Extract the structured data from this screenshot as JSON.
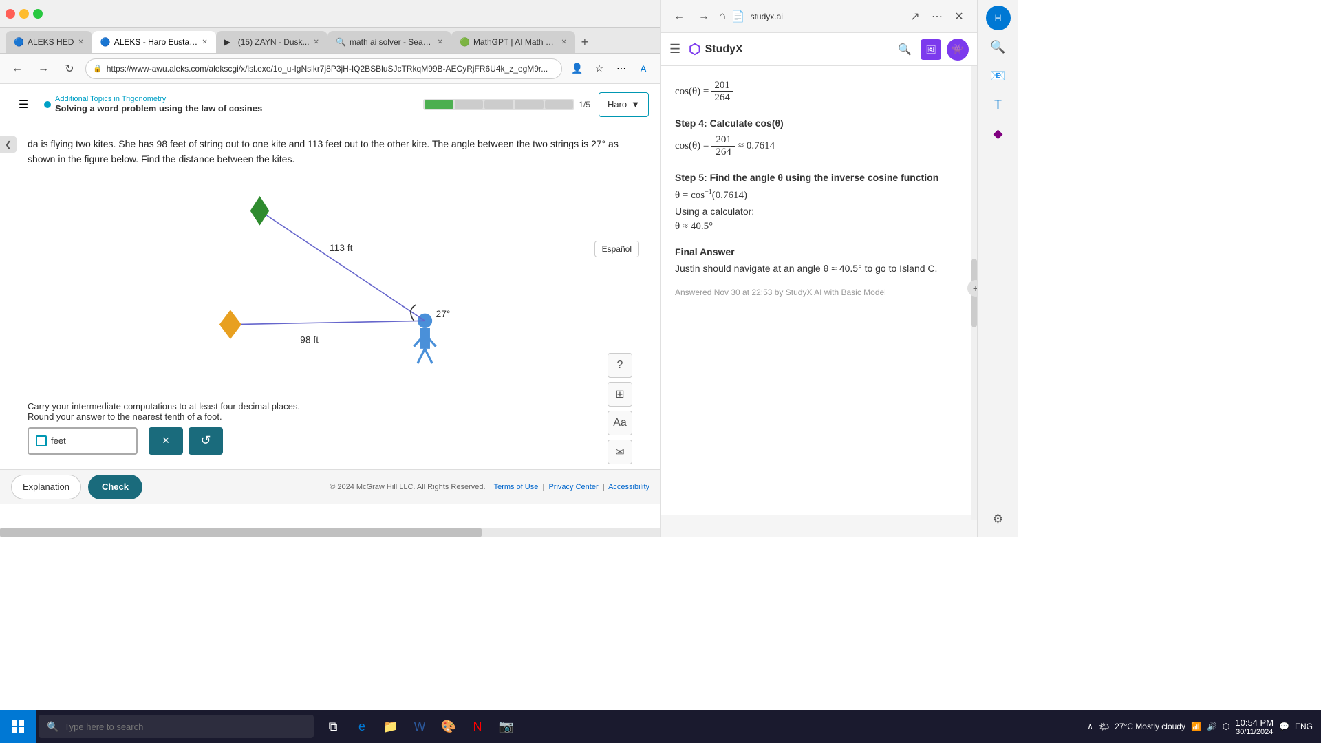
{
  "browser": {
    "tabs": [
      {
        "id": "aleks-hed",
        "title": "ALEKS HED",
        "favicon": "🔵",
        "active": false
      },
      {
        "id": "aleks-haro",
        "title": "ALEKS - Haro Eustaquio...",
        "favicon": "🔵",
        "active": true
      },
      {
        "id": "zayn",
        "title": "(15) ZAYN - Dusk...",
        "favicon": "🔴",
        "active": false
      },
      {
        "id": "math-search",
        "title": "math ai solver - Search",
        "favicon": "🔍",
        "active": false
      },
      {
        "id": "mathgpt",
        "title": "MathGPT | AI Math Sol...",
        "favicon": "🟢",
        "active": false
      }
    ],
    "address": "https://www-awu.aleks.com/alekscgi/x/lsl.exe/1o_u-IgNslkr7j8P3jH-IQ2BSBluSJcTRkqM99B-AECyRjFR6U4k_z_egM9r...",
    "new_tab_label": "+"
  },
  "aleks": {
    "menu_icon": "☰",
    "topic_subtitle": "Additional Topics in Trigonometry",
    "topic_title": "Solving a word problem using the law of cosines",
    "progress_segments": 5,
    "progress_filled": 1,
    "progress_text": "1/5",
    "profile_name": "Haro",
    "espanol_label": "Español",
    "problem_text": "da is flying two kites. She has 98 feet of string out to one kite and 113 feet out to the other kite. The angle between the two strings is 27° as shown in the figure below. Find the distance between the kites.",
    "diagram": {
      "kite1_label": "113 ft",
      "kite2_label": "98 ft",
      "angle_label": "27°"
    },
    "instructions": "Carry your intermediate computations to at least four decimal places.\nRound your answer to the nearest tenth of a foot.",
    "answer_unit": "feet",
    "btn_x_label": "×",
    "btn_reset_label": "↺",
    "footer": {
      "explanation_label": "Explanation",
      "check_label": "Check",
      "copyright": "© 2024 McGraw Hill LLC. All Rights Reserved.",
      "terms_label": "Terms of Use",
      "privacy_label": "Privacy Center",
      "accessibility_label": "Accessibility"
    }
  },
  "studyx": {
    "url": "studyx.ai",
    "logo_text": "StudyX",
    "content": {
      "step4_title": "Step 4: Calculate cos(θ)",
      "step4_num": "201",
      "step4_den": "264",
      "step4_approx": "≈ 0.7614",
      "step5_title": "Step 5: Find the angle θ using the inverse cosine function",
      "step5_formula": "θ = cos⁻¹(0.7614)",
      "step5_calculator": "Using a calculator:",
      "step5_approx": "θ ≈ 40.5°",
      "final_title": "Final Answer",
      "final_text": "Justin should navigate at an angle θ ≈ 40.5° to go to Island C.",
      "answered_text": "Answered Nov 30 at 22:53 by StudyX AI with Basic Model"
    },
    "prev_section": {
      "cos_theta": "cos(θ) =",
      "num": "201",
      "den": "264"
    }
  },
  "taskbar": {
    "search_placeholder": "Type here to search",
    "weather": "27°C  Mostly cloudy",
    "time": "10:54 PM",
    "date": "30/11/2024",
    "eng_label": "ENG"
  }
}
